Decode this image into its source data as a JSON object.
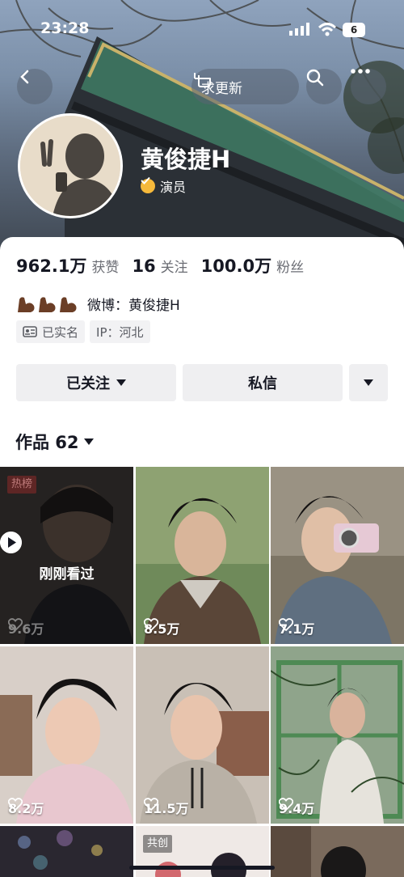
{
  "status_bar": {
    "time": "23:28",
    "battery": "6"
  },
  "header": {
    "update_label": "求更新",
    "name": "黄俊捷H",
    "verify_label": "演员"
  },
  "stats": [
    {
      "value": "962.1万",
      "label": "获赞"
    },
    {
      "value": "16",
      "label": "关注"
    },
    {
      "value": "100.0万",
      "label": "粉丝"
    }
  ],
  "bio": {
    "weibo": "微博：黄俊捷H"
  },
  "tags": [
    {
      "icon": "id-card-icon",
      "label": "已实名"
    },
    {
      "icon": "",
      "label": "IP：河北"
    }
  ],
  "actions": {
    "follow_label": "已关注",
    "message_label": "私信"
  },
  "works": {
    "label": "作品 62"
  },
  "videos": [
    {
      "likes": "9.6万",
      "badge": "热榜",
      "watched": "刚刚看过"
    },
    {
      "likes": "8.5万"
    },
    {
      "likes": "7.1万"
    },
    {
      "likes": "8.2万"
    },
    {
      "likes": "11.5万"
    },
    {
      "likes": "9.4万"
    },
    {
      "badge": "共创"
    }
  ],
  "colors": {
    "accent_verify": "#f6b93b",
    "button_bg": "#efeff1",
    "text_primary": "#161823",
    "text_secondary": "#6b6d74"
  }
}
